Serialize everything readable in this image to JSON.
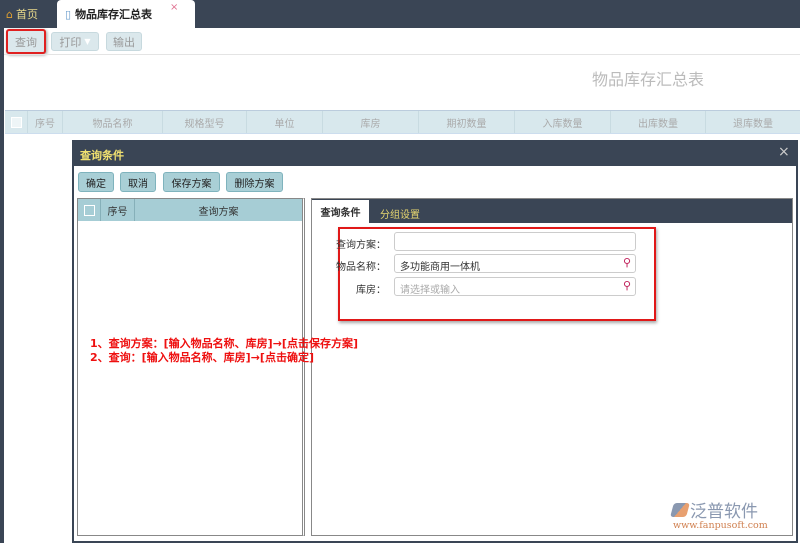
{
  "tabs": {
    "home": "首页",
    "active": "物品库存汇总表",
    "close": "×"
  },
  "toolbar": {
    "query": "查询",
    "print": "打印",
    "print_arrow": "▼",
    "export": "输出"
  },
  "report_title": "物品库存汇总表",
  "table": {
    "columns": [
      "序号",
      "物品名称",
      "规格型号",
      "单位",
      "库房",
      "期初数量",
      "入库数量",
      "出库数量",
      "退库数量"
    ]
  },
  "dialog": {
    "title": "查询条件",
    "close": "×",
    "buttons": {
      "ok": "确定",
      "cancel": "取消",
      "save": "保存方案",
      "delete": "删除方案"
    },
    "scheme_list": {
      "columns": [
        "序号",
        "查询方案"
      ]
    },
    "tabs": {
      "conditions": "查询条件",
      "grouping": "分组设置"
    },
    "fields": {
      "scheme": {
        "label": "查询方案：",
        "value": ""
      },
      "item_name": {
        "label": "物品名称：",
        "value": "多功能商用一体机"
      },
      "warehouse": {
        "label": "库房：",
        "placeholder": "请选择或输入"
      }
    }
  },
  "annotations": [
    "1、查询方案：[输入物品名称、库房]→[点击保存方案]",
    "2、查询：[输入物品名称、库房]→[点击确定]"
  ],
  "watermark": {
    "brand": "泛普软件",
    "url": "www.fanpusoft.com"
  }
}
